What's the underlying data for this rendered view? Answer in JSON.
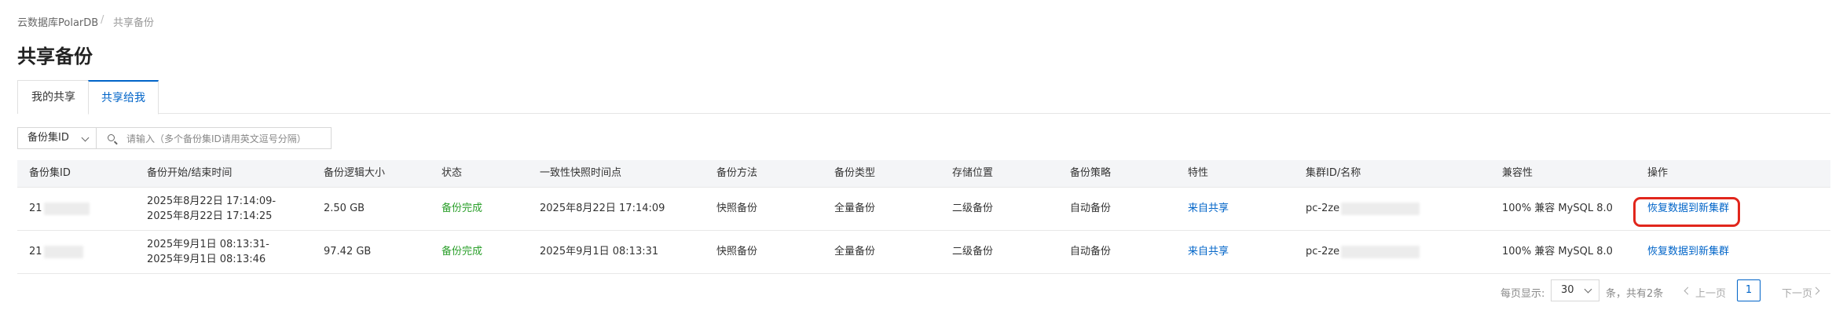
{
  "breadcrumb": {
    "items": [
      "云数据库PolarDB",
      "共享备份"
    ],
    "separator": "/"
  },
  "page": {
    "title": "共享备份"
  },
  "tabs": [
    {
      "label": "我的共享",
      "active": false
    },
    {
      "label": "共享给我",
      "active": true
    }
  ],
  "filter": {
    "select_value": "备份集ID",
    "placeholder": "请输入（多个备份集ID请用英文逗号分隔）"
  },
  "table": {
    "headers": [
      "备份集ID",
      "备份开始/结束时间",
      "备份逻辑大小",
      "状态",
      "一致性快照时间点",
      "备份方法",
      "备份类型",
      "存储位置",
      "备份策略",
      "特性",
      "集群ID/名称",
      "兼容性",
      "操作"
    ],
    "rows": [
      {
        "backup_id": "21",
        "time_start": "2025年8月22日 17:14:09-",
        "time_end": "2025年8月22日 17:14:25",
        "size": "2.50 GB",
        "status": "备份完成",
        "snapshot_time": "2025年8月22日 17:14:09",
        "method": "快照备份",
        "type": "全量备份",
        "location": "二级备份",
        "policy": "自动备份",
        "feature": "来自共享",
        "cluster": "pc-2ze",
        "compat": "100% 兼容 MySQL 8.0",
        "action": "恢复数据到新集群",
        "highlighted": true
      },
      {
        "backup_id": "21",
        "time_start": "2025年9月1日 08:13:31-",
        "time_end": "2025年9月1日 08:13:46",
        "size": "97.42 GB",
        "status": "备份完成",
        "snapshot_time": "2025年9月1日 08:13:31",
        "method": "快照备份",
        "type": "全量备份",
        "location": "二级备份",
        "policy": "自动备份",
        "feature": "来自共享",
        "cluster": "pc-2ze",
        "compat": "100% 兼容 MySQL 8.0",
        "action": "恢复数据到新集群",
        "highlighted": false
      }
    ]
  },
  "pagination": {
    "per_page_label": "每页显示:",
    "per_page_value": "30",
    "total_text": "条，共有2条",
    "prev_label": "上一页",
    "current_page": "1",
    "next_label": "下一页"
  },
  "colors": {
    "accent": "#0064c8",
    "success": "#2ca02c",
    "highlight_border": "#e1261c"
  }
}
